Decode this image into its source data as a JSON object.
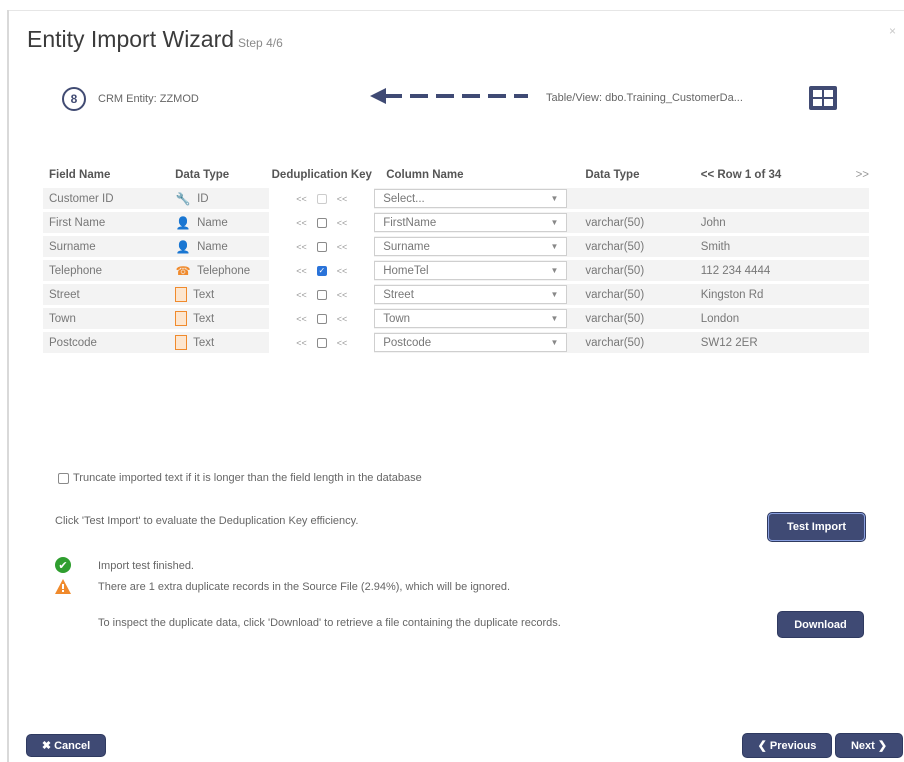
{
  "window": {
    "title": "Entity Import Wizard",
    "step": "Step 4/6"
  },
  "crm": {
    "label": "CRM Entity: ZZMOD",
    "table_label": "Table/View: dbo.Training_CustomerDa..."
  },
  "table": {
    "headers": {
      "field_name": "Field Name",
      "data_type": "Data Type",
      "dedup": "Deduplication Key",
      "column_name": "Column Name",
      "src_data_type": "Data Type",
      "row_prev": "<< Row 1 of 34",
      "row_next": ">>"
    },
    "rows": [
      {
        "field": "Customer ID",
        "type": "ID",
        "icon": "key-icon",
        "dedup": false,
        "column": "Select...",
        "src_type": "",
        "value": ""
      },
      {
        "field": "First Name",
        "type": "Name",
        "icon": "name-icon",
        "dedup": false,
        "column": "FirstName",
        "src_type": "varchar(50)",
        "value": "John"
      },
      {
        "field": "Surname",
        "type": "Name",
        "icon": "name-icon",
        "dedup": false,
        "column": "Surname",
        "src_type": "varchar(50)",
        "value": "Smith"
      },
      {
        "field": "Telephone",
        "type": "Telephone",
        "icon": "phone-icon",
        "dedup": true,
        "column": "HomeTel",
        "src_type": "varchar(50)",
        "value": "112 234 4444"
      },
      {
        "field": "Street",
        "type": "Text",
        "icon": "text-icon",
        "dedup": false,
        "column": "Street",
        "src_type": "varchar(50)",
        "value": "Kingston Rd"
      },
      {
        "field": "Town",
        "type": "Text",
        "icon": "text-icon",
        "dedup": false,
        "column": "Town",
        "src_type": "varchar(50)",
        "value": "London"
      },
      {
        "field": "Postcode",
        "type": "Text",
        "icon": "text-icon",
        "dedup": false,
        "column": "Postcode",
        "src_type": "varchar(50)",
        "value": "SW12 2ER"
      }
    ]
  },
  "options": {
    "truncate_label": "Truncate imported text if it is longer than the field length in the database",
    "test_info": "Click 'Test Import' to evaluate the Deduplication Key efficiency.",
    "test_button": "Test Import"
  },
  "results": {
    "finished": "Import test finished.",
    "duplicates": "There are 1 extra duplicate records in the Source File (2.94%), which will be ignored.",
    "inspect": "To inspect the duplicate data, click 'Download' to retrieve a file containing the duplicate records.",
    "download_button": "Download"
  },
  "footer": {
    "cancel": "Cancel",
    "previous": "Previous",
    "next": "Next"
  },
  "colors": {
    "primary": "#3f4a74",
    "accent_orange": "#f08a2c",
    "success": "#2f9e2f",
    "checkbox_on": "#2a73d9"
  }
}
